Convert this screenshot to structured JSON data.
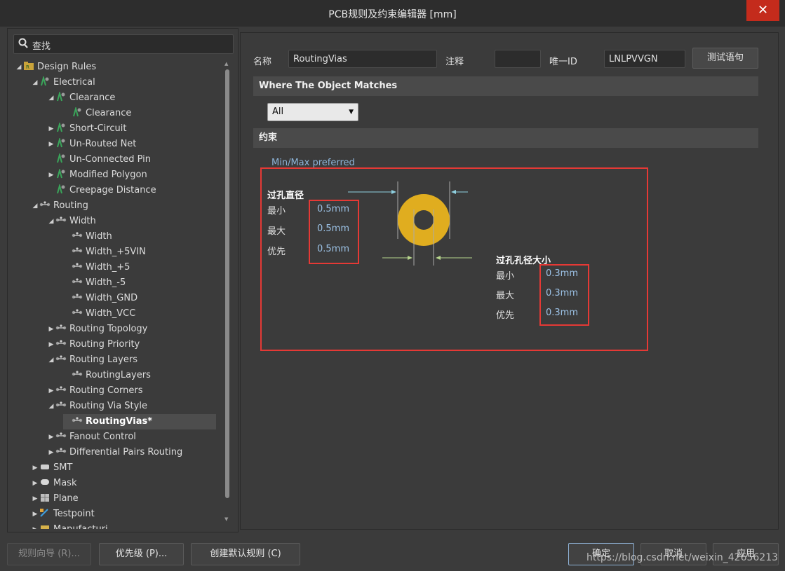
{
  "window": {
    "title": "PCB规则及约束编辑器 [mm]",
    "close_glyph": "✕"
  },
  "search": {
    "value": "查找"
  },
  "tree": [
    {
      "label": "Design Rules",
      "arrow": "◢",
      "icon": "design-rules-icon"
    },
    {
      "label": "Electrical",
      "arrow": "◢",
      "icon": "electrical-rule-icon"
    },
    {
      "label": "Clearance",
      "arrow": "◢",
      "icon": "electrical-rule-icon"
    },
    {
      "label": "Clearance",
      "arrow": "",
      "icon": "electrical-rule-icon"
    },
    {
      "label": "Short-Circuit",
      "arrow": "▶",
      "icon": "electrical-rule-icon"
    },
    {
      "label": "Un-Routed Net",
      "arrow": "▶",
      "icon": "electrical-rule-icon"
    },
    {
      "label": "Un-Connected Pin",
      "arrow": "",
      "icon": "electrical-rule-icon"
    },
    {
      "label": "Modified Polygon",
      "arrow": "▶",
      "icon": "electrical-rule-icon"
    },
    {
      "label": "Creepage Distance",
      "arrow": "",
      "icon": "electrical-rule-icon"
    },
    {
      "label": "Routing",
      "arrow": "◢",
      "icon": "routing-rule-icon"
    },
    {
      "label": "Width",
      "arrow": "◢",
      "icon": "routing-rule-icon"
    },
    {
      "label": "Width",
      "arrow": "",
      "icon": "routing-rule-icon"
    },
    {
      "label": "Width_+5VIN",
      "arrow": "",
      "icon": "routing-rule-icon"
    },
    {
      "label": "Width_+5",
      "arrow": "",
      "icon": "routing-rule-icon"
    },
    {
      "label": "Width_-5",
      "arrow": "",
      "icon": "routing-rule-icon"
    },
    {
      "label": "Width_GND",
      "arrow": "",
      "icon": "routing-rule-icon"
    },
    {
      "label": "Width_VCC",
      "arrow": "",
      "icon": "routing-rule-icon"
    },
    {
      "label": "Routing Topology",
      "arrow": "▶",
      "icon": "routing-rule-icon"
    },
    {
      "label": "Routing Priority",
      "arrow": "▶",
      "icon": "routing-rule-icon"
    },
    {
      "label": "Routing Layers",
      "arrow": "◢",
      "icon": "routing-rule-icon"
    },
    {
      "label": "RoutingLayers",
      "arrow": "",
      "icon": "routing-rule-icon"
    },
    {
      "label": "Routing Corners",
      "arrow": "▶",
      "icon": "routing-rule-icon"
    },
    {
      "label": "Routing Via Style",
      "arrow": "◢",
      "icon": "routing-rule-icon"
    },
    {
      "label": "RoutingVias*",
      "arrow": "",
      "icon": "routing-rule-icon",
      "selected": true
    },
    {
      "label": "Fanout Control",
      "arrow": "▶",
      "icon": "routing-rule-icon"
    },
    {
      "label": "Differential Pairs Routing",
      "arrow": "▶",
      "icon": "routing-rule-icon"
    },
    {
      "label": "SMT",
      "arrow": "▶",
      "icon": "smt-rule-icon"
    },
    {
      "label": "Mask",
      "arrow": "▶",
      "icon": "mask-rule-icon"
    },
    {
      "label": "Plane",
      "arrow": "▶",
      "icon": "plane-rule-icon"
    },
    {
      "label": "Testpoint",
      "arrow": "▶",
      "icon": "testpoint-rule-icon"
    },
    {
      "label": "Manufacturi...",
      "arrow": "▶",
      "icon": "manufacturing-rule-icon"
    }
  ],
  "rule": {
    "name_label": "名称",
    "name_value": "RoutingVias",
    "comment_label": "注释",
    "comment_value": "",
    "uid_label": "唯一ID",
    "uid_value": "LNLPVVGN",
    "test_button": "测试语句"
  },
  "match": {
    "header": "Where The Object Matches",
    "selected": "All"
  },
  "constraint": {
    "header": "约束",
    "mode": "Min/Max preferred",
    "via_diameter": {
      "title": "过孔直径",
      "min_label": "最小",
      "max_label": "最大",
      "pref_label": "优先",
      "min": "0.5mm",
      "max": "0.5mm",
      "pref": "0.5mm"
    },
    "hole_size": {
      "title": "过孔孔径大小",
      "min_label": "最小",
      "max_label": "最大",
      "pref_label": "优先",
      "min": "0.3mm",
      "max": "0.3mm",
      "pref": "0.3mm"
    },
    "via_color": "#e0ad1f"
  },
  "footer": {
    "wizard": "规则向导 (R)...",
    "priority": "优先级 (P)...",
    "create_default": "创建默认规则 (C)",
    "ok": "确定",
    "cancel": "取消",
    "apply": "应用"
  },
  "watermark": "https://blog.csdn.net/weixin_42656213"
}
